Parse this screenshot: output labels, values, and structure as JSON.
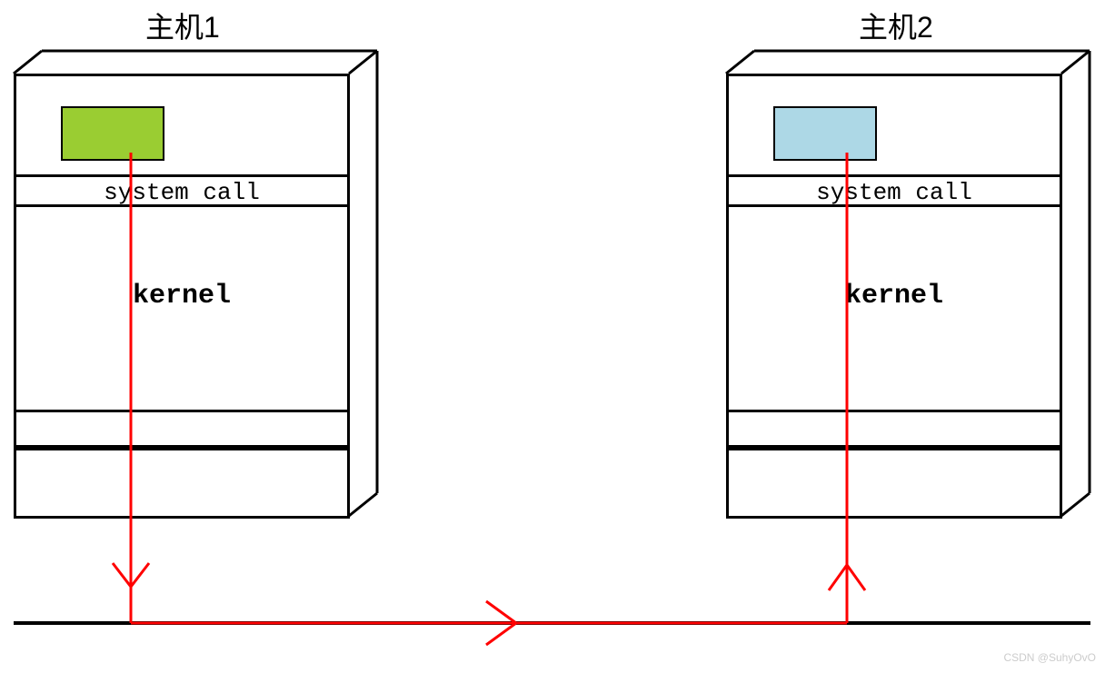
{
  "diagram": {
    "host1": {
      "title": "主机1",
      "system_call": "system call",
      "kernel": "kernel",
      "app_color": "#9ACD32"
    },
    "host2": {
      "title": "主机2",
      "system_call": "system call",
      "kernel": "kernel",
      "app_color": "#ADD8E6"
    },
    "arrow_color": "#FF0000",
    "watermark": "CSDN @SuhyOvO"
  }
}
